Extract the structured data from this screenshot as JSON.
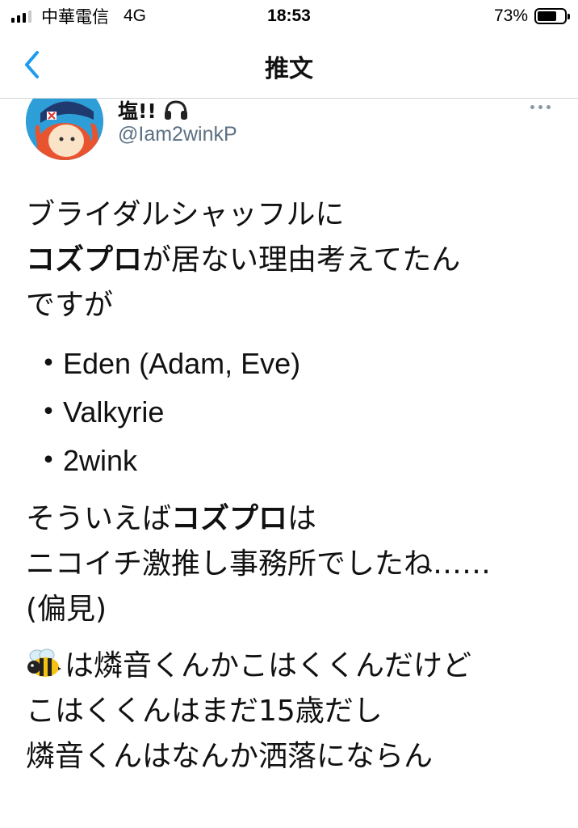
{
  "status_bar": {
    "carrier": "中華電信",
    "network": "4G",
    "time": "18:53",
    "battery_percent": "73%",
    "battery_level": 0.73
  },
  "nav": {
    "title": "推文"
  },
  "author": {
    "display_name": "塩!!",
    "handle": "@Iam2winkP"
  },
  "tweet": {
    "p1_l1": "ブライダルシャッフルに",
    "p1_l2_bold": "コズプロ",
    "p1_l2_rest": "が居ない理由考えてたん",
    "p1_l3": "ですが",
    "bullet_marker": "・",
    "bullets": [
      "Eden (Adam, Eve)",
      "Valkyrie",
      "2wink"
    ],
    "p2_l1_pre": "そういえば",
    "p2_l1_bold": "コズプロ",
    "p2_l1_post": "は",
    "p2_l2": "ニコイチ激推し事務所でしたね……",
    "p2_l3": "(偏見)",
    "p3_l1": "は燐音くんかこはくくんだけど",
    "p3_l2": "こはくくんはまだ15歳だし",
    "p3_l3": "燐音くんはなんか洒落にならん"
  },
  "icons": {
    "back": "chevron-left-icon",
    "more": "more-dots-icon",
    "headphones": "headphones-icon",
    "bee": "bee-emoji-icon"
  },
  "colors": {
    "accent": "#1d9bf0",
    "handle": "#5b7083",
    "divider": "#cfd5d9"
  }
}
